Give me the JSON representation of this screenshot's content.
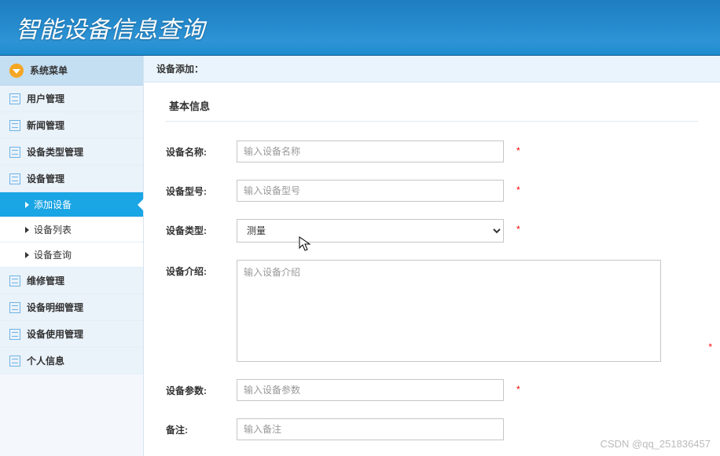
{
  "header": {
    "title": "智能设备信息查询"
  },
  "sidebar": {
    "menu_title": "系统菜单",
    "items": [
      {
        "label": "用户管理"
      },
      {
        "label": "新闻管理"
      },
      {
        "label": "设备类型管理"
      },
      {
        "label": "设备管理"
      },
      {
        "label": "维修管理"
      },
      {
        "label": "设备明细管理"
      },
      {
        "label": "设备使用管理"
      },
      {
        "label": "个人信息"
      }
    ],
    "sub_items": [
      {
        "label": "添加设备",
        "active": true
      },
      {
        "label": "设备列表",
        "active": false
      },
      {
        "label": "设备查询",
        "active": false
      }
    ]
  },
  "main": {
    "breadcrumb": "设备添加：",
    "section_title": "基本信息",
    "fields": {
      "name": {
        "label": "设备名称:",
        "placeholder": "输入设备名称",
        "required": "*"
      },
      "model": {
        "label": "设备型号:",
        "placeholder": "输入设备型号",
        "required": "*"
      },
      "type": {
        "label": "设备类型:",
        "selected": "测量",
        "required": "*"
      },
      "intro": {
        "label": "设备介绍:",
        "placeholder": "输入设备介绍",
        "required": "*"
      },
      "params": {
        "label": "设备参数:",
        "placeholder": "输入设备参数",
        "required": "*"
      },
      "remark": {
        "label": "备注:",
        "placeholder": "输入备注"
      }
    }
  },
  "watermark": "CSDN @qq_251836457"
}
